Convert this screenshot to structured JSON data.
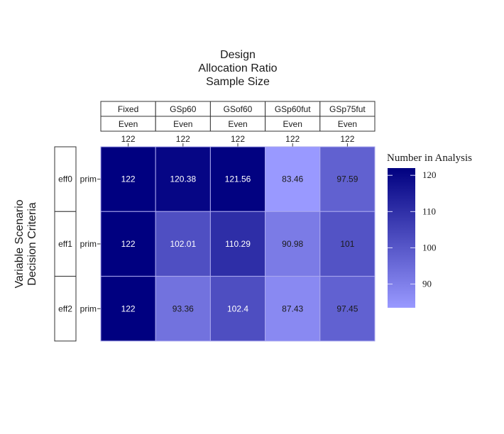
{
  "chart_data": {
    "type": "heatmap",
    "title_lines": [
      "Design",
      "Allocation Ratio",
      "Sample Size"
    ],
    "ylabel_lines": [
      "Variable Scenario",
      "Decision Criteria"
    ],
    "columns": [
      {
        "design": "Fixed",
        "allocation": "Even",
        "sample_size": "122"
      },
      {
        "design": "GSp60",
        "allocation": "Even",
        "sample_size": "122"
      },
      {
        "design": "GSof60",
        "allocation": "Even",
        "sample_size": "122"
      },
      {
        "design": "GSp60fut",
        "allocation": "Even",
        "sample_size": "122"
      },
      {
        "design": "GSp75fut",
        "allocation": "Even",
        "sample_size": "122"
      }
    ],
    "rows": [
      {
        "scenario": "eff0",
        "criteria": "prim"
      },
      {
        "scenario": "eff1",
        "criteria": "prim"
      },
      {
        "scenario": "eff2",
        "criteria": "prim"
      }
    ],
    "values": [
      [
        122,
        120.38,
        121.56,
        83.46,
        97.59
      ],
      [
        122,
        102.01,
        110.29,
        90.98,
        101
      ],
      [
        122,
        93.36,
        102.4,
        87.43,
        97.45
      ]
    ],
    "value_labels": [
      [
        "122",
        "120.38",
        "121.56",
        "83.46",
        "97.59"
      ],
      [
        "122",
        "102.01",
        "110.29",
        "90.98",
        "101"
      ],
      [
        "122",
        "93.36",
        "102.4",
        "87.43",
        "97.45"
      ]
    ],
    "legend": {
      "title": "Number in Analysis",
      "position": "right",
      "ticks": [
        120,
        110,
        100,
        90
      ],
      "tick_labels": [
        "120",
        "110",
        "100",
        "90"
      ],
      "range": [
        83.46,
        122
      ],
      "low_color": "#9999ff",
      "high_color": "#000080"
    },
    "label_text_threshold": 100
  }
}
